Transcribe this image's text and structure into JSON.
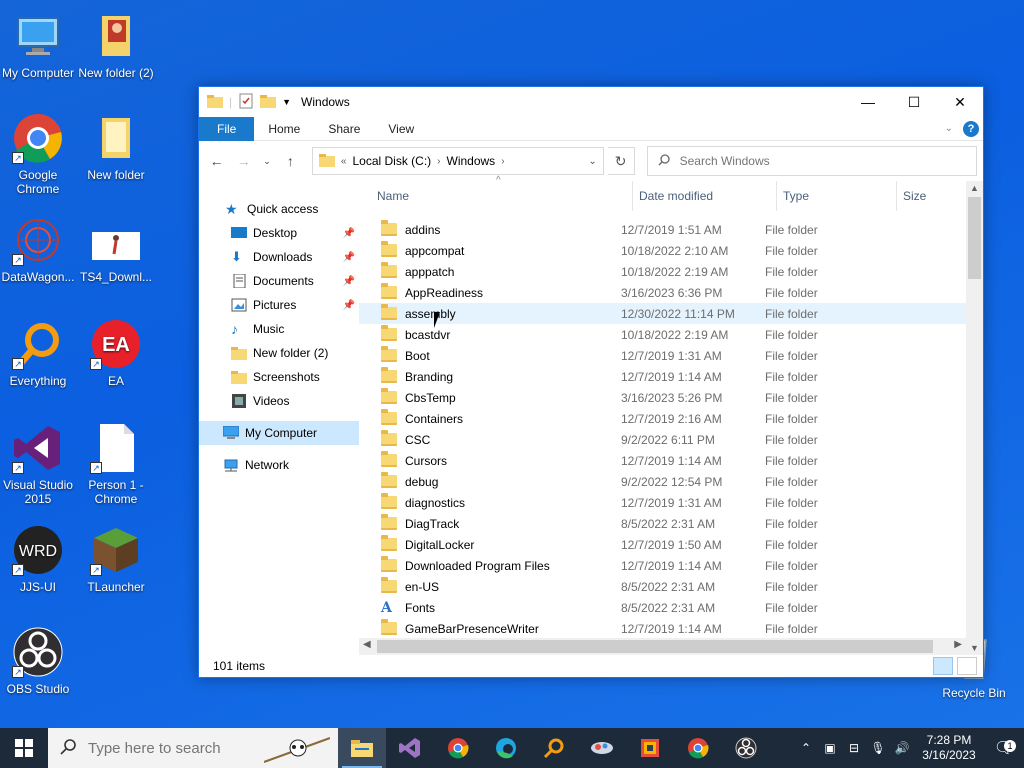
{
  "desktop": {
    "icons": [
      {
        "label": "My Computer"
      },
      {
        "label": "New folder (2)"
      },
      {
        "label": "Google Chrome"
      },
      {
        "label": "New folder"
      },
      {
        "label": "DataWagon..."
      },
      {
        "label": "TS4_Downl..."
      },
      {
        "label": "Everything"
      },
      {
        "label": "EA"
      },
      {
        "label": "Visual Studio 2015"
      },
      {
        "label": "Person 1 - Chrome"
      },
      {
        "label": "JJS-UI"
      },
      {
        "label": "TLauncher"
      },
      {
        "label": "OBS Studio"
      },
      {
        "label": "Recycle Bin"
      }
    ],
    "wrd_text": "WRD",
    "ea_text": "EA"
  },
  "window": {
    "title": "Windows",
    "ribbon_tabs": [
      "File",
      "Home",
      "Share",
      "View"
    ],
    "address": {
      "prefix": "«",
      "crumbs": [
        "Local Disk (C:)",
        "Windows"
      ]
    },
    "search_placeholder": "Search Windows",
    "nav": {
      "quick_access": "Quick access",
      "items": [
        "Desktop",
        "Downloads",
        "Documents",
        "Pictures",
        "Music",
        "New folder (2)",
        "Screenshots",
        "Videos"
      ],
      "my_computer": "My Computer",
      "network": "Network"
    },
    "columns": [
      "Name",
      "Date modified",
      "Type",
      "Size"
    ],
    "rows": [
      {
        "name": "addins",
        "date": "12/7/2019 1:51 AM",
        "type": "File folder"
      },
      {
        "name": "appcompat",
        "date": "10/18/2022 2:10 AM",
        "type": "File folder"
      },
      {
        "name": "apppatch",
        "date": "10/18/2022 2:19 AM",
        "type": "File folder"
      },
      {
        "name": "AppReadiness",
        "date": "3/16/2023 6:36 PM",
        "type": "File folder"
      },
      {
        "name": "assembly",
        "date": "12/30/2022 11:14 PM",
        "type": "File folder"
      },
      {
        "name": "bcastdvr",
        "date": "10/18/2022 2:19 AM",
        "type": "File folder"
      },
      {
        "name": "Boot",
        "date": "12/7/2019 1:31 AM",
        "type": "File folder"
      },
      {
        "name": "Branding",
        "date": "12/7/2019 1:14 AM",
        "type": "File folder"
      },
      {
        "name": "CbsTemp",
        "date": "3/16/2023 5:26 PM",
        "type": "File folder"
      },
      {
        "name": "Containers",
        "date": "12/7/2019 2:16 AM",
        "type": "File folder"
      },
      {
        "name": "CSC",
        "date": "9/2/2022 6:11 PM",
        "type": "File folder"
      },
      {
        "name": "Cursors",
        "date": "12/7/2019 1:14 AM",
        "type": "File folder"
      },
      {
        "name": "debug",
        "date": "9/2/2022 12:54 PM",
        "type": "File folder"
      },
      {
        "name": "diagnostics",
        "date": "12/7/2019 1:31 AM",
        "type": "File folder"
      },
      {
        "name": "DiagTrack",
        "date": "8/5/2022 2:31 AM",
        "type": "File folder"
      },
      {
        "name": "DigitalLocker",
        "date": "12/7/2019 1:50 AM",
        "type": "File folder"
      },
      {
        "name": "Downloaded Program Files",
        "date": "12/7/2019 1:14 AM",
        "type": "File folder"
      },
      {
        "name": "en-US",
        "date": "8/5/2022 2:31 AM",
        "type": "File folder"
      },
      {
        "name": "Fonts",
        "date": "8/5/2022 2:31 AM",
        "type": "File folder"
      },
      {
        "name": "GameBarPresenceWriter",
        "date": "12/7/2019 1:14 AM",
        "type": "File folder"
      }
    ],
    "status": "101 items"
  },
  "taskbar": {
    "search_placeholder": "Type here to search",
    "time": "7:28 PM",
    "date": "3/16/2023",
    "notification_count": "1"
  }
}
